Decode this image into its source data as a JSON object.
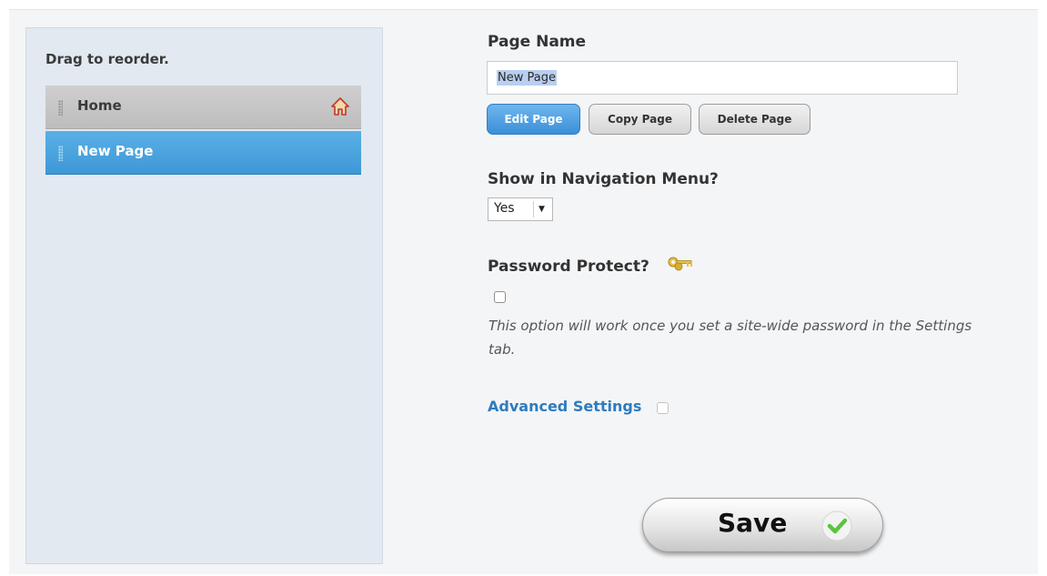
{
  "sidebar": {
    "hint": "Drag to reorder.",
    "items": [
      {
        "label": "Home",
        "icon": "home-icon",
        "selected": false
      },
      {
        "label": "New Page",
        "selected": true
      }
    ]
  },
  "form": {
    "page_name_label": "Page Name",
    "page_name_value": "New Page",
    "buttons": {
      "edit": "Edit Page",
      "copy": "Copy Page",
      "delete": "Delete Page"
    },
    "nav_menu_label": "Show in Navigation Menu?",
    "nav_menu_value": "Yes",
    "password_label": "Password Protect?",
    "password_icon": "keys-icon",
    "password_checked": false,
    "password_note": "This option will work once you set a site-wide password in the Settings tab.",
    "advanced_settings": "Advanced Settings",
    "save": "Save"
  },
  "colors": {
    "accent_blue": "#3e98d6",
    "link_blue": "#2d7bbf",
    "sidebar_bg": "#e2e9f1",
    "save_check_green": "#5cc43b"
  }
}
